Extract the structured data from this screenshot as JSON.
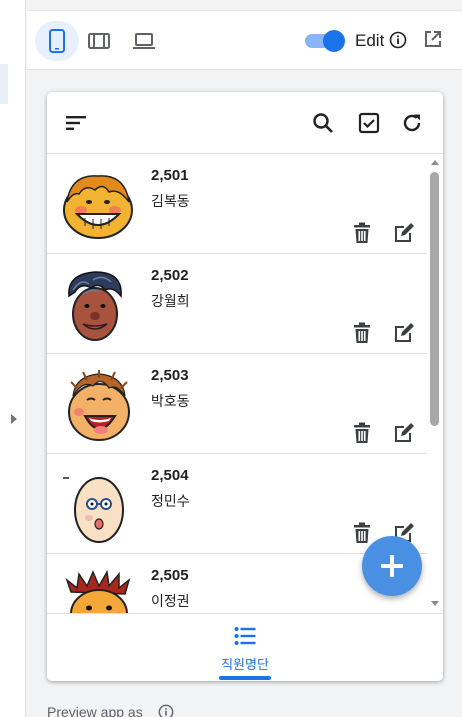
{
  "toolbar": {
    "edit_label": "Edit",
    "edit_enabled": true,
    "accent_color": "#1a73e8"
  },
  "app": {
    "icons": [
      "sort-icon",
      "search-icon",
      "checkbox-icon",
      "refresh-icon"
    ],
    "employees": [
      {
        "id": "2,501",
        "name": "김복동"
      },
      {
        "id": "2,502",
        "name": "강월희"
      },
      {
        "id": "2,503",
        "name": "박호동"
      },
      {
        "id": "2,504",
        "name": "정민수"
      },
      {
        "id": "2,505",
        "name": "이정권"
      }
    ],
    "fab_icon": "plus-icon",
    "bottom_nav": {
      "label": "직원명단",
      "icon": "list-icon"
    }
  },
  "footer": {
    "preview_label": "Preview app as"
  }
}
